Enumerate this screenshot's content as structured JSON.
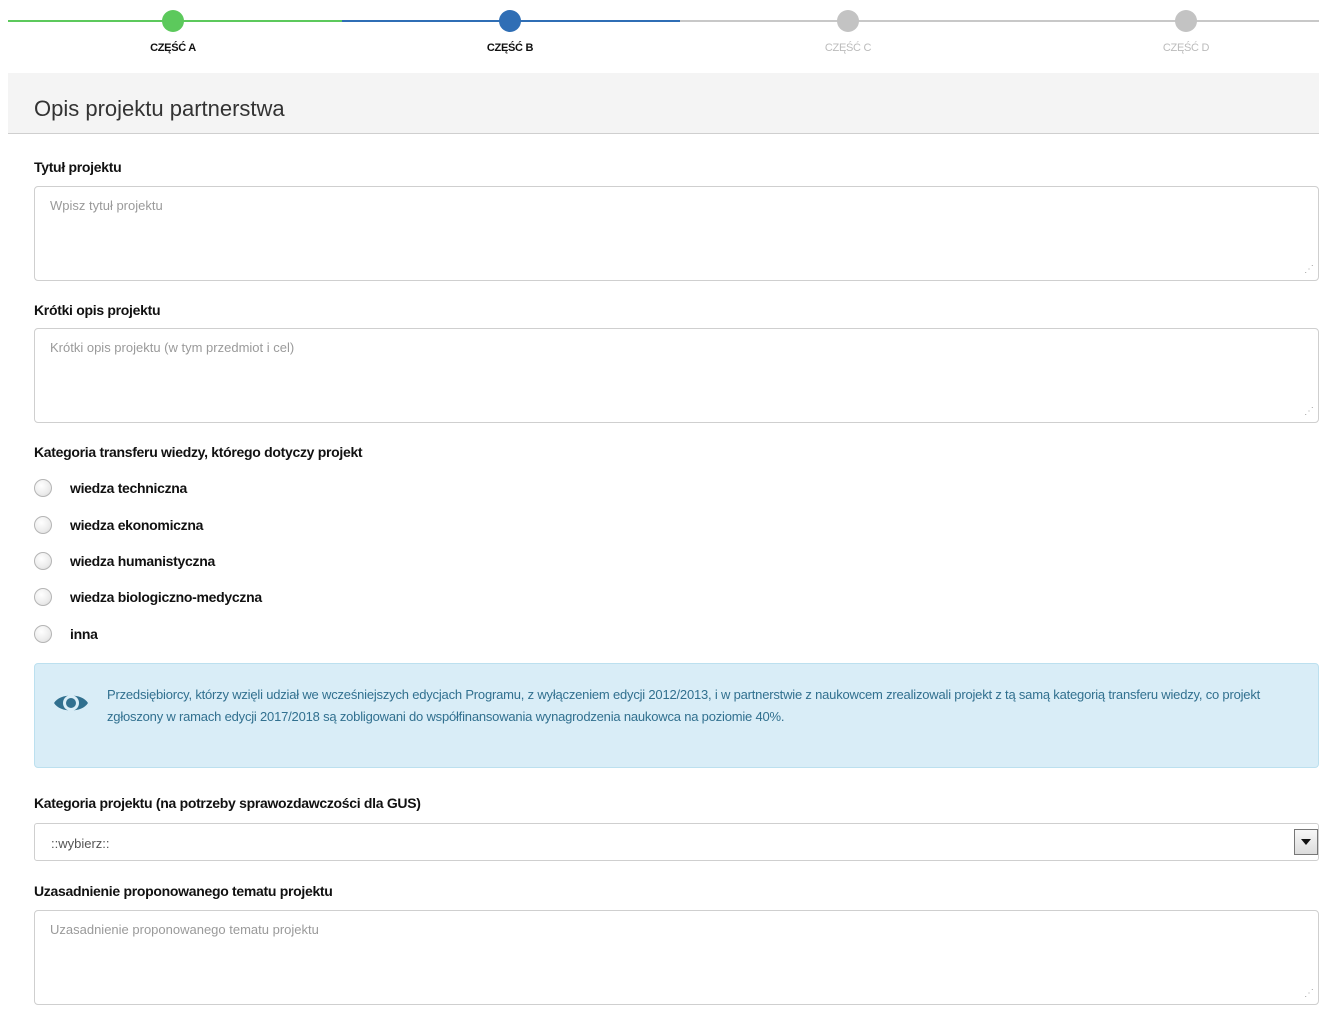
{
  "stepper": {
    "steps": [
      {
        "label": "CZĘŚĆ A",
        "state": "completed",
        "color": "#5cc95c"
      },
      {
        "label": "CZĘŚĆ B",
        "state": "current",
        "color": "#2f6eb5"
      },
      {
        "label": "CZĘŚĆ C",
        "state": "pending",
        "color": "#c3c3c3"
      },
      {
        "label": "CZĘŚĆ D",
        "state": "pending",
        "color": "#c3c3c3"
      }
    ]
  },
  "panel": {
    "title": "Opis projektu partnerstwa"
  },
  "form": {
    "title_field": {
      "label": "Tytuł projektu",
      "placeholder": "Wpisz tytuł projektu",
      "value": ""
    },
    "description_field": {
      "label": "Krótki opis projektu",
      "placeholder": "Krótki opis projektu (w tym przedmiot i cel)",
      "value": ""
    },
    "transfer_category": {
      "label": "Kategoria transferu wiedzy, którego dotyczy projekt",
      "options": [
        {
          "label": "wiedza techniczna"
        },
        {
          "label": "wiedza ekonomiczna"
        },
        {
          "label": "wiedza humanistyczna"
        },
        {
          "label": "wiedza biologiczno-medyczna"
        },
        {
          "label": "inna"
        }
      ]
    },
    "info": {
      "icon": "eye-icon",
      "text": "Przedsiębiorcy, którzy wzięli udział we wcześniejszych edycjach Programu, z wyłączeniem edycji 2012/2013, i w partnerstwie z naukowcem zrealizowali projekt z tą samą kategorią transferu wiedzy, co projekt zgłoszony w ramach edycji 2017/2018 są zobligowani do współfinansowania wynagrodzenia naukowca na poziomie 40%."
    },
    "project_category": {
      "label": "Kategoria projektu (na potrzeby sprawozdawczości dla GUS)",
      "selected": "::wybierz::"
    },
    "justification_field": {
      "label": "Uzasadnienie proponowanego tematu projektu",
      "placeholder": "Uzasadnienie proponowanego tematu projektu",
      "value": ""
    }
  }
}
